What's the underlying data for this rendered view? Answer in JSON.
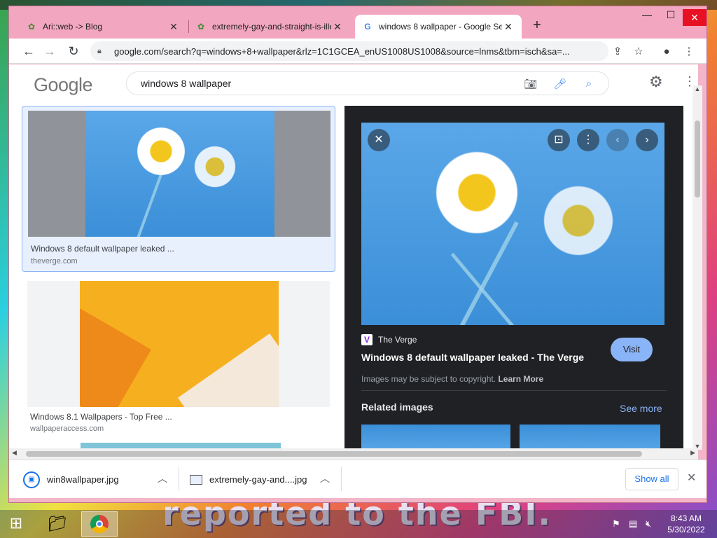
{
  "desktop": {
    "background_text": "reported to the FBI."
  },
  "tabs": [
    {
      "favicon": "glyph",
      "title": "Ari::web -> Blog"
    },
    {
      "favicon": "glyph",
      "title": "extremely-gay-and-straight-is-illeg"
    },
    {
      "favicon": "G",
      "title": "windows 8 wallpaper - Google Se"
    }
  ],
  "window_controls": {
    "minimize": "—",
    "maximize": "☐",
    "close": "✕"
  },
  "toolbar": {
    "url": "google.com/search?q=windows+8+wallpaper&rlz=1C1GCEA_enUS1008US1008&source=lnms&tbm=isch&sa=..."
  },
  "google": {
    "logo": "Google",
    "query": "windows 8 wallpaper"
  },
  "results": [
    {
      "title": "Windows 8 default wallpaper leaked ...",
      "site": "theverge.com"
    },
    {
      "title": "Windows 8.1 Wallpapers - Top Free ...",
      "site": "wallpaperaccess.com"
    }
  ],
  "preview": {
    "source": "The Verge",
    "source_logo": "V",
    "title": "Windows 8 default wallpaper leaked - The Verge",
    "visit_label": "Visit",
    "copyright": "Images may be subject to copyright.",
    "learn_more": "Learn More",
    "related_heading": "Related images",
    "see_more": "See more"
  },
  "downloads": [
    {
      "file": "win8wallpaper.jpg"
    },
    {
      "file": "extremely-gay-and....jpg"
    }
  ],
  "download_bar": {
    "show_all": "Show all"
  },
  "taskbar": {
    "time": "8:43 AM",
    "date": "5/30/2022"
  },
  "colors": {
    "tab_strip": "#f3a6bf",
    "accent_blue": "#8ab4f8",
    "panel_dark": "#202124"
  }
}
